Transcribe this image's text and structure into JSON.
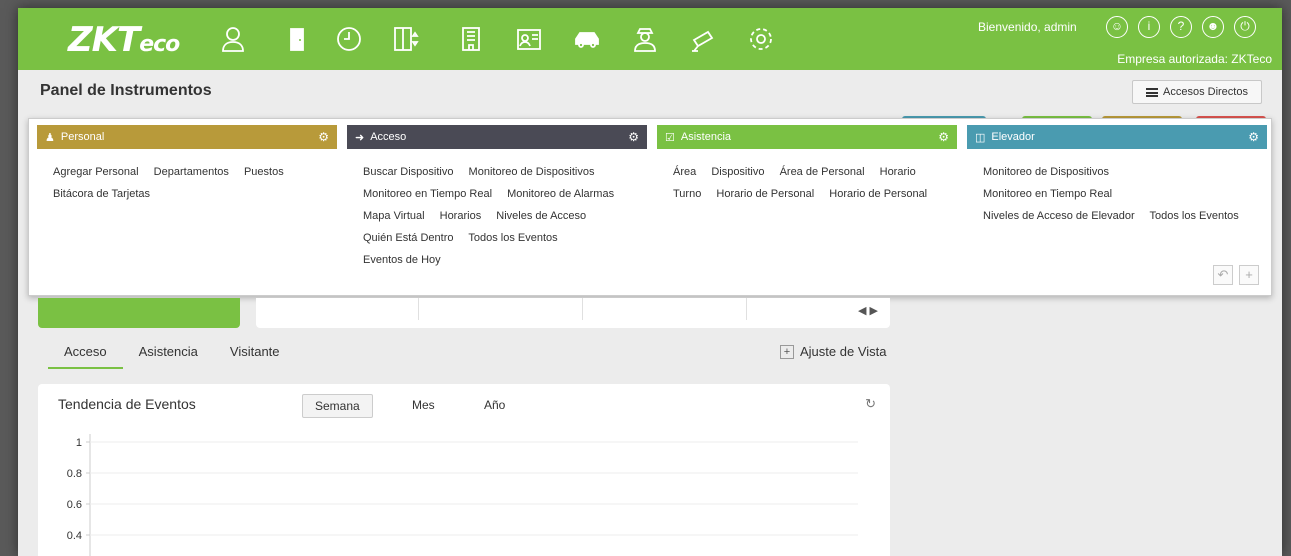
{
  "topbar": {
    "logo_main": "ZKT",
    "logo_suffix": "eco",
    "welcome": "Bienvenido, admin",
    "empresa": "Empresa autorizada: ZKTeco",
    "modules": [
      "personnel-icon",
      "door-icon",
      "clock-icon",
      "elevator-icon",
      "building-icon",
      "visitor-icon",
      "car-icon",
      "guard-icon",
      "camera-icon",
      "settings-icon"
    ],
    "right_icons": [
      "user-circle-icon",
      "info-icon",
      "help-icon",
      "account-icon",
      "power-icon"
    ]
  },
  "header": {
    "title": "Panel de Instrumentos",
    "quick_access": "Accesos Directos"
  },
  "panel": {
    "columns": [
      {
        "title": "Personal",
        "color": "#b89a3a",
        "icon": "persons-icon",
        "links": [
          "Agregar Personal",
          "Departamentos",
          "Puestos",
          "Bitácora de Tarjetas"
        ]
      },
      {
        "title": "Acceso",
        "color": "#4a4a55",
        "icon": "door-enter-icon",
        "links": [
          "Buscar Dispositivo",
          "Monitoreo de Dispositivos",
          "Monitoreo en Tiempo Real",
          "Monitoreo de Alarmas",
          "Mapa Virtual",
          "Horarios",
          "Niveles de Acceso",
          "Quién Está Dentro",
          "Todos los Eventos",
          "Eventos de Hoy"
        ]
      },
      {
        "title": "Asistencia",
        "color": "#7ac143",
        "icon": "calendar-check-icon",
        "links": [
          "Área",
          "Dispositivo",
          "Área de Personal",
          "Horario",
          "Turno",
          "Horario de Personal",
          "Horario de Personal"
        ]
      },
      {
        "title": "Elevador",
        "color": "#4a9bb0",
        "icon": "elevator-icon",
        "links": [
          "Monitoreo de Dispositivos",
          "Monitoreo en Tiempo Real",
          "Niveles de Acceso de Elevador",
          "Todos los Eventos"
        ]
      }
    ]
  },
  "tabs": [
    "Acceso",
    "Asistencia",
    "Visitante"
  ],
  "ajuste": "Ajuste de Vista",
  "chart_card": {
    "title": "Tendencia de Eventos",
    "ranges": [
      "Semana",
      "Mes",
      "Año"
    ],
    "selected_range": "Semana"
  },
  "chart_data": {
    "type": "line",
    "title": "",
    "yticks": [
      "1",
      "0.8",
      "0.6",
      "0.4"
    ],
    "ylim": [
      0,
      1
    ],
    "series": [],
    "grid": true
  }
}
